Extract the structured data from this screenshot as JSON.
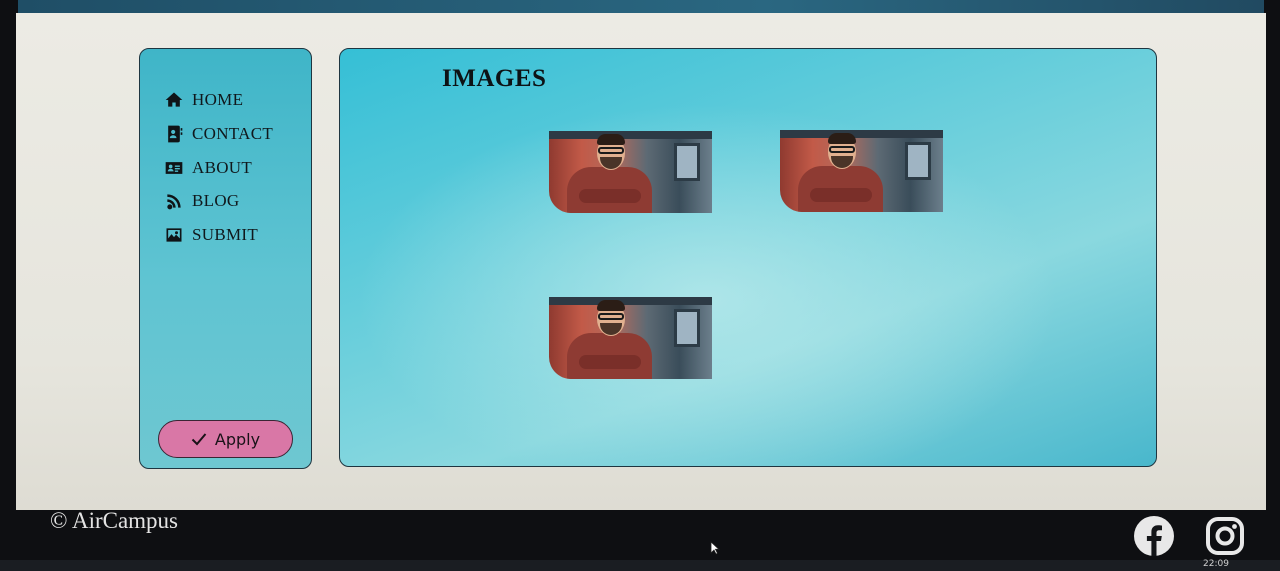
{
  "nav": {
    "items": [
      {
        "label": "HOME",
        "icon": "home-icon"
      },
      {
        "label": "CONTACT",
        "icon": "contact-card-icon"
      },
      {
        "label": "ABOUT",
        "icon": "id-card-icon"
      },
      {
        "label": "BLOG",
        "icon": "blog-icon"
      },
      {
        "label": "SUBMIT",
        "icon": "image-icon"
      }
    ],
    "apply_label": "Apply"
  },
  "main": {
    "title": "IMAGES",
    "images": [
      {
        "subject": "smiling man with glasses in red sweater"
      },
      {
        "subject": "smiling man with glasses in red sweater"
      },
      {
        "subject": "smiling man with glasses in red sweater"
      }
    ]
  },
  "footer": {
    "copyright": "© AirCampus",
    "social": [
      "facebook-icon",
      "instagram-icon"
    ]
  },
  "system": {
    "clock": "22:09"
  },
  "colors": {
    "sidebar_bg": "#4dbccc",
    "main_bg": "#6fd0dc",
    "apply_button": "#d977a6",
    "footer_bg": "#0e0f12"
  }
}
